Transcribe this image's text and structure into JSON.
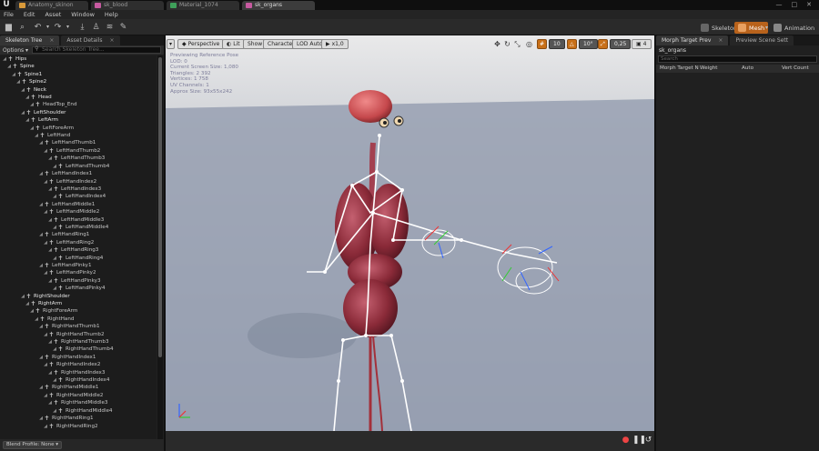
{
  "window": {
    "tabs": [
      {
        "label": "Anatomy_skinon",
        "color": "#d99a3a",
        "active": false
      },
      {
        "label": "sk_blood",
        "color": "#c75aa0",
        "active": false
      },
      {
        "label": "Material_1074",
        "color": "#3fa05a",
        "active": false
      },
      {
        "label": "sk_organs",
        "color": "#c75aa0",
        "active": true
      }
    ],
    "controls": [
      "—",
      "□",
      "✕"
    ]
  },
  "menu": [
    "File",
    "Edit",
    "Asset",
    "Window",
    "Help"
  ],
  "toolbar": {
    "modes": [
      {
        "label": "Skeleton",
        "active": false
      },
      {
        "label": "Mesh",
        "active": true
      },
      {
        "label": "Animation",
        "active": false
      }
    ]
  },
  "left_panel": {
    "tabs": [
      {
        "label": "Skeleton Tree",
        "active": true
      },
      {
        "label": "Asset Details",
        "active": false
      }
    ],
    "options_label": "Options ▾",
    "search_placeholder": "Search Skeleton Tree...",
    "blend_profile": "Blend Profile: None ▾",
    "tree": [
      {
        "label": "Hips",
        "depth": 0,
        "root": true
      },
      {
        "label": "Spine",
        "depth": 1,
        "root": true
      },
      {
        "label": "Spine1",
        "depth": 2,
        "root": true
      },
      {
        "label": "Spine2",
        "depth": 3,
        "root": true
      },
      {
        "label": "Neck",
        "depth": 4,
        "root": true
      },
      {
        "label": "Head",
        "depth": 5,
        "root": true
      },
      {
        "label": "HeadTop_End",
        "depth": 6,
        "root": false
      },
      {
        "label": "LeftShoulder",
        "depth": 4,
        "root": true
      },
      {
        "label": "LeftArm",
        "depth": 5,
        "root": true
      },
      {
        "label": "LeftForeArm",
        "depth": 6,
        "root": false
      },
      {
        "label": "LeftHand",
        "depth": 7,
        "root": false
      },
      {
        "label": "LeftHandThumb1",
        "depth": 8,
        "root": false
      },
      {
        "label": "LeftHandThumb2",
        "depth": 9,
        "root": false
      },
      {
        "label": "LeftHandThumb3",
        "depth": 10,
        "root": false
      },
      {
        "label": "LeftHandThumb4",
        "depth": 11,
        "root": false
      },
      {
        "label": "LeftHandIndex1",
        "depth": 8,
        "root": false
      },
      {
        "label": "LeftHandIndex2",
        "depth": 9,
        "root": false
      },
      {
        "label": "LeftHandIndex3",
        "depth": 10,
        "root": false
      },
      {
        "label": "LeftHandIndex4",
        "depth": 11,
        "root": false
      },
      {
        "label": "LeftHandMiddle1",
        "depth": 8,
        "root": false
      },
      {
        "label": "LeftHandMiddle2",
        "depth": 9,
        "root": false
      },
      {
        "label": "LeftHandMiddle3",
        "depth": 10,
        "root": false
      },
      {
        "label": "LeftHandMiddle4",
        "depth": 11,
        "root": false
      },
      {
        "label": "LeftHandRing1",
        "depth": 8,
        "root": false
      },
      {
        "label": "LeftHandRing2",
        "depth": 9,
        "root": false
      },
      {
        "label": "LeftHandRing3",
        "depth": 10,
        "root": false
      },
      {
        "label": "LeftHandRing4",
        "depth": 11,
        "root": false
      },
      {
        "label": "LeftHandPinky1",
        "depth": 8,
        "root": false
      },
      {
        "label": "LeftHandPinky2",
        "depth": 9,
        "root": false
      },
      {
        "label": "LeftHandPinky3",
        "depth": 10,
        "root": false
      },
      {
        "label": "LeftHandPinky4",
        "depth": 11,
        "root": false
      },
      {
        "label": "RightShoulder",
        "depth": 4,
        "root": true
      },
      {
        "label": "RightArm",
        "depth": 5,
        "root": true
      },
      {
        "label": "RightForeArm",
        "depth": 6,
        "root": false
      },
      {
        "label": "RightHand",
        "depth": 7,
        "root": false
      },
      {
        "label": "RightHandThumb1",
        "depth": 8,
        "root": false
      },
      {
        "label": "RightHandThumb2",
        "depth": 9,
        "root": false
      },
      {
        "label": "RightHandThumb3",
        "depth": 10,
        "root": false
      },
      {
        "label": "RightHandThumb4",
        "depth": 11,
        "root": false
      },
      {
        "label": "RightHandIndex1",
        "depth": 8,
        "root": false
      },
      {
        "label": "RightHandIndex2",
        "depth": 9,
        "root": false
      },
      {
        "label": "RightHandIndex3",
        "depth": 10,
        "root": false
      },
      {
        "label": "RightHandIndex4",
        "depth": 11,
        "root": false
      },
      {
        "label": "RightHandMiddle1",
        "depth": 8,
        "root": false
      },
      {
        "label": "RightHandMiddle2",
        "depth": 9,
        "root": false
      },
      {
        "label": "RightHandMiddle3",
        "depth": 10,
        "root": false
      },
      {
        "label": "RightHandMiddle4",
        "depth": 11,
        "root": false
      },
      {
        "label": "RightHandRing1",
        "depth": 8,
        "root": false
      },
      {
        "label": "RightHandRing2",
        "depth": 9,
        "root": false
      }
    ]
  },
  "viewport": {
    "perspective": "Perspective",
    "lit": "Lit",
    "show": "Show",
    "character": "Character",
    "lod": "LOD Auto",
    "speed": "x1,0",
    "grid_snap": "10",
    "rot_snap": "10°",
    "scale_snap": "0,25",
    "cam_speed": "4",
    "stats": [
      "Previewing Reference Pose",
      "LOD: 0",
      "Current Screen Size: 1,080",
      "Triangles: 2 392",
      "Vertices: 1 758",
      "UV Channels: 1",
      "Approx Size: 93x55x242"
    ],
    "background_color": "#9aa2b2"
  },
  "right_panel": {
    "tabs": [
      {
        "label": "Morph Target Prev",
        "active": true
      },
      {
        "label": "Preview Scene Sett",
        "active": false
      }
    ],
    "asset_name": "sk_organs",
    "search_placeholder": "Search",
    "columns": [
      "Morph Target N",
      "Weight",
      "Auto",
      "Vert Count"
    ]
  }
}
